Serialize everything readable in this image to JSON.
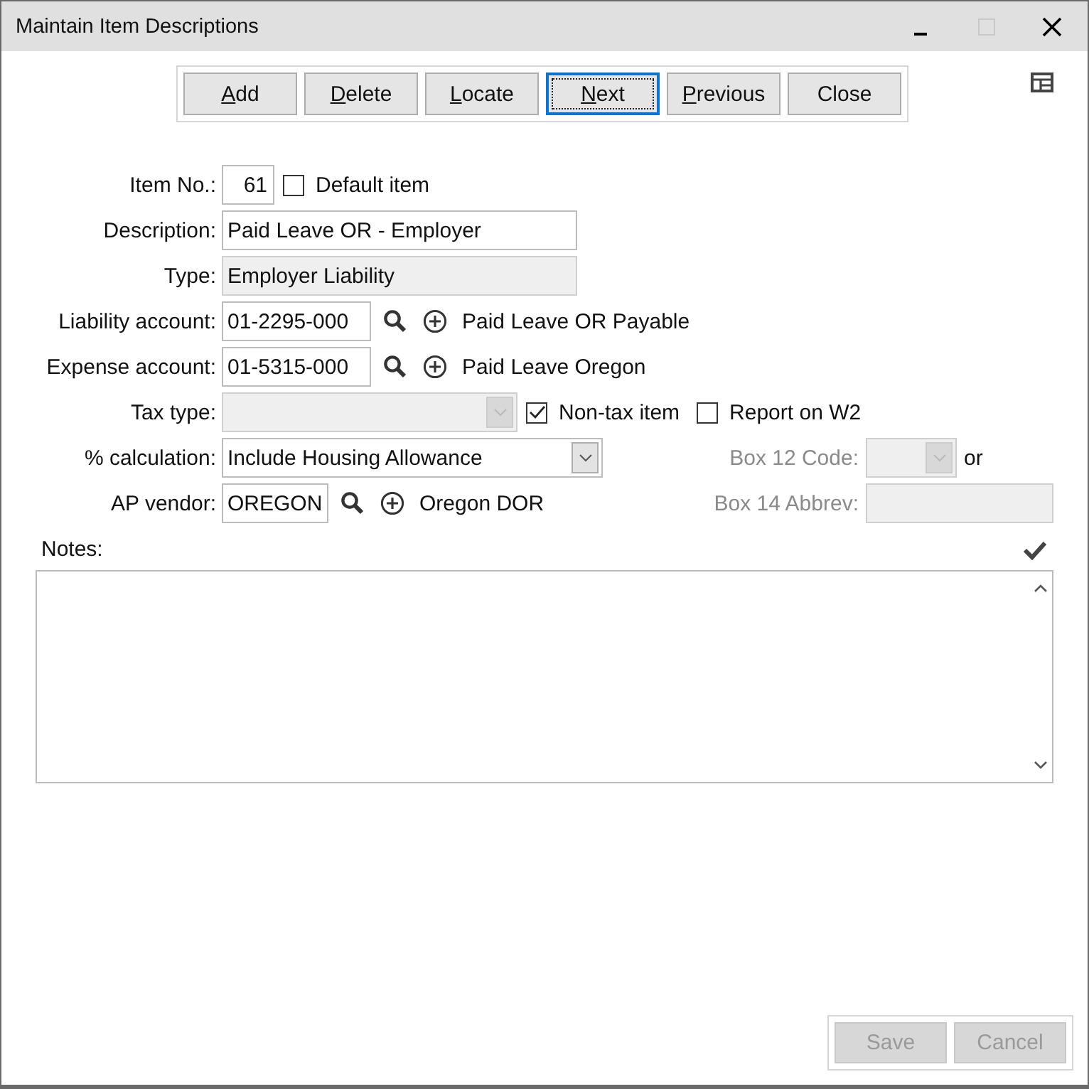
{
  "window": {
    "title": "Maintain Item Descriptions",
    "maximize_disabled": true
  },
  "toolbar": [
    {
      "label": "Add",
      "access_key": true,
      "focused": false
    },
    {
      "label": "Delete",
      "access_key": true,
      "focused": false
    },
    {
      "label": "Locate",
      "access_key": true,
      "focused": false
    },
    {
      "label": "Next",
      "access_key": true,
      "focused": true
    },
    {
      "label": "Previous",
      "access_key": true,
      "focused": false
    },
    {
      "label": "Close",
      "access_key": false,
      "focused": false
    }
  ],
  "fields": [
    {
      "kind": "number",
      "label": "Item No.:",
      "value": "61",
      "disabled": false,
      "checkboxes": [
        {
          "label": "Default item",
          "checked": false
        }
      ]
    },
    {
      "kind": "text",
      "label": "Description:",
      "value": "Paid Leave OR - Employer",
      "disabled": false
    },
    {
      "kind": "text",
      "label": "Type:",
      "value": "Employer Liability",
      "disabled": true
    },
    {
      "kind": "account",
      "label": "Liability account:",
      "value": "01-2295-000",
      "disabled": false,
      "lookup_name": "Paid Leave OR Payable"
    },
    {
      "kind": "account",
      "label": "Expense account:",
      "value": "01-5315-000",
      "disabled": false,
      "lookup_name": "Paid Leave Oregon"
    },
    {
      "kind": "select",
      "label": "Tax type:",
      "disabled": true,
      "checkboxes": [
        {
          "label": "Non-tax item",
          "checked": true
        },
        {
          "label": "Report on W2",
          "checked": false
        }
      ]
    },
    {
      "kind": "select",
      "label": "% calculation:",
      "value": "Include Housing Allowance",
      "disabled": false,
      "side": {
        "kind": "select",
        "label": "Box 12 Code:",
        "disabled": true,
        "suffix": "or"
      }
    },
    {
      "kind": "vendor",
      "label": "AP vendor:",
      "value": "OREGON",
      "disabled": false,
      "lookup_name": "Oregon DOR",
      "side": {
        "kind": "text",
        "label": "Box 14 Abbrev:",
        "disabled": true
      }
    }
  ],
  "notes": {
    "label": "Notes:"
  },
  "footer": [
    {
      "label": "Save",
      "disabled": true
    },
    {
      "label": "Cancel",
      "disabled": true
    }
  ]
}
